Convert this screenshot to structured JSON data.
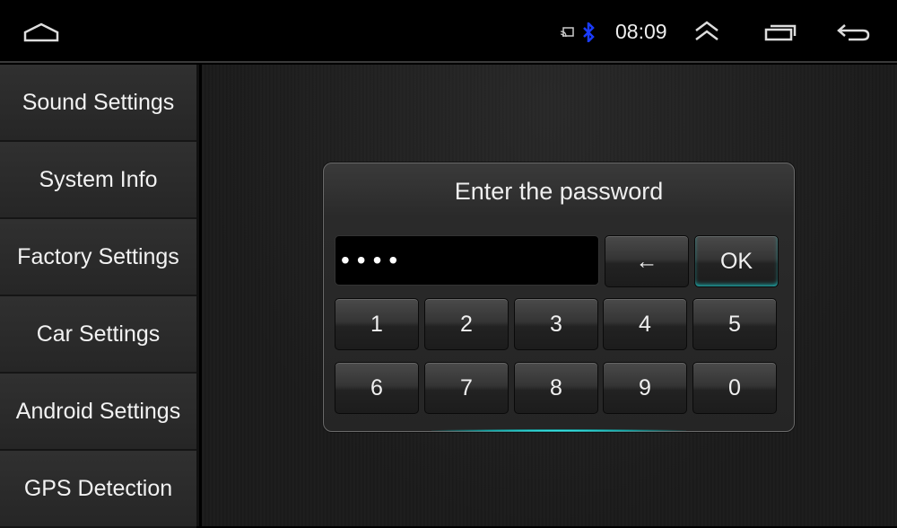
{
  "status_bar": {
    "time": "08:09",
    "icons": [
      "home-icon",
      "cast-icon",
      "bluetooth-icon",
      "expand-up-icon",
      "recent-apps-icon",
      "back-icon"
    ],
    "bluetooth_color": "#1a3cff"
  },
  "sidebar": {
    "items": [
      {
        "label": "Sound Settings"
      },
      {
        "label": "System Info"
      },
      {
        "label": "Factory Settings"
      },
      {
        "label": "Car Settings"
      },
      {
        "label": "Android Settings"
      },
      {
        "label": "GPS Detection"
      }
    ]
  },
  "dialog": {
    "title": "Enter the password",
    "password_value": "••••",
    "backspace_label": "←",
    "ok_label": "OK",
    "keys": [
      "1",
      "2",
      "3",
      "4",
      "5",
      "6",
      "7",
      "8",
      "9",
      "0"
    ],
    "accent_color": "#33e0e0"
  }
}
